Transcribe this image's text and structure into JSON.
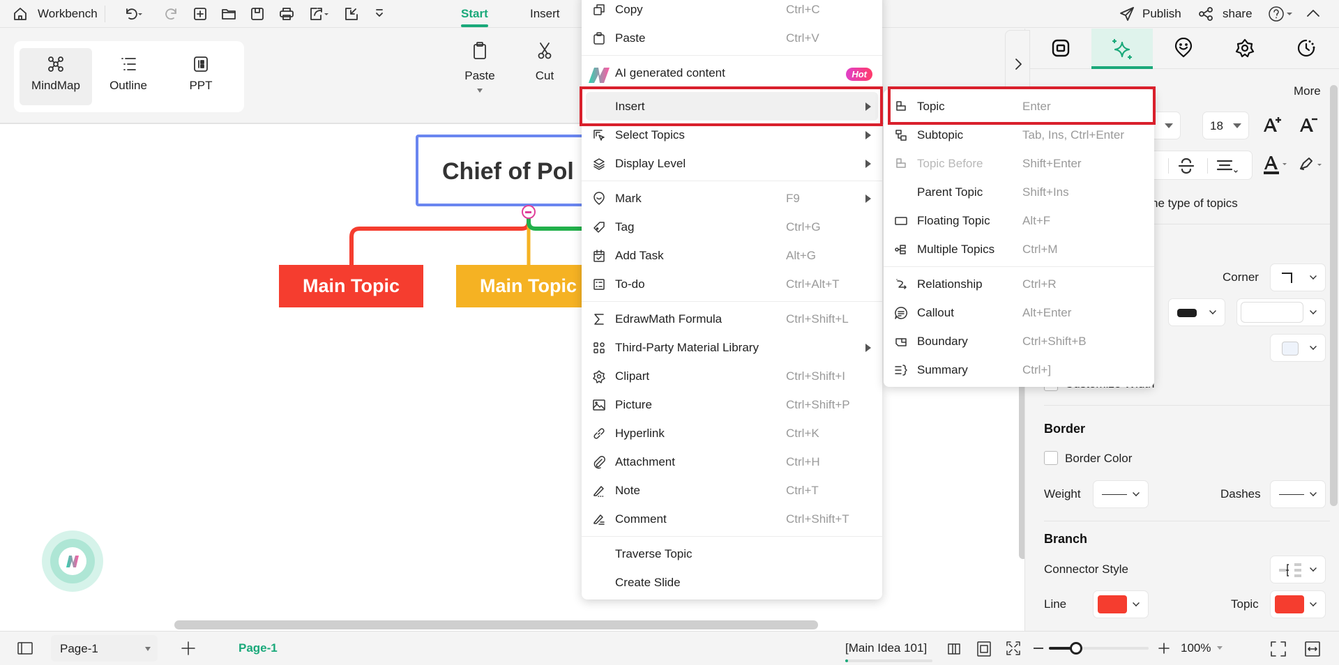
{
  "topbar": {
    "workbench_label": "Workbench",
    "tabs": [
      {
        "label": "Start",
        "active": true
      },
      {
        "label": "Insert",
        "active": false
      }
    ],
    "publish_label": "Publish",
    "share_label": "share"
  },
  "ribbon": {
    "views": [
      {
        "label": "MindMap",
        "selected": true
      },
      {
        "label": "Outline"
      },
      {
        "label": "PPT"
      }
    ],
    "paste_label": "Paste",
    "cut_label": "Cut"
  },
  "canvas": {
    "root_topic": "Chief of Pol",
    "main_topics": [
      {
        "label": "Main Topic",
        "color": "#f53d2f"
      },
      {
        "label": "Main Topic",
        "color": "#f5b223"
      }
    ],
    "branch_colors": {
      "red": "#f53d2f",
      "yellow": "#f5b223",
      "green": "#22b04b"
    },
    "root_border_color": "#6a86f0"
  },
  "context_menu": {
    "groups": [
      [
        {
          "label": "Copy",
          "shortcut": "Ctrl+C",
          "icon": "copy"
        },
        {
          "label": "Paste",
          "shortcut": "Ctrl+V",
          "icon": "paste"
        }
      ],
      [
        {
          "label": "AI generated content",
          "icon": "ai-logo",
          "badge": "Hot",
          "ai": true
        },
        {
          "label": "Insert",
          "submenu": true,
          "highlighted": true
        },
        {
          "label": "Select Topics",
          "icon": "select",
          "submenu": true
        },
        {
          "label": "Display Level",
          "icon": "layers",
          "submenu": true
        }
      ],
      [
        {
          "label": "Mark",
          "shortcut": "F9",
          "icon": "mark",
          "submenu": true
        },
        {
          "label": "Tag",
          "shortcut": "Ctrl+G",
          "icon": "tag"
        },
        {
          "label": "Add Task",
          "shortcut": "Alt+G",
          "icon": "task"
        },
        {
          "label": "To-do",
          "shortcut": "Ctrl+Alt+T",
          "icon": "todo"
        }
      ],
      [
        {
          "label": "EdrawMath Formula",
          "shortcut": "Ctrl+Shift+L",
          "icon": "sigma"
        },
        {
          "label": "Third-Party Material Library",
          "icon": "grid",
          "submenu": true
        },
        {
          "label": "Clipart",
          "shortcut": "Ctrl+Shift+I",
          "icon": "clipart"
        },
        {
          "label": "Picture",
          "shortcut": "Ctrl+Shift+P",
          "icon": "picture"
        },
        {
          "label": "Hyperlink",
          "shortcut": "Ctrl+K",
          "icon": "link"
        },
        {
          "label": "Attachment",
          "shortcut": "Ctrl+H",
          "icon": "clip"
        },
        {
          "label": "Note",
          "shortcut": "Ctrl+T",
          "icon": "note"
        },
        {
          "label": "Comment",
          "shortcut": "Ctrl+Shift+T",
          "icon": "comment"
        }
      ],
      [
        {
          "label": "Traverse Topic"
        },
        {
          "label": "Create Slide"
        }
      ]
    ]
  },
  "insert_submenu": {
    "groups": [
      [
        {
          "label": "Topic",
          "shortcut": "Enter",
          "icon": "topic"
        },
        {
          "label": "Subtopic",
          "shortcut": "Tab, Ins, Ctrl+Enter",
          "icon": "subtopic"
        },
        {
          "label": "Topic Before",
          "shortcut": "Shift+Enter",
          "icon": "topic",
          "disabled": true
        },
        {
          "label": "Parent Topic",
          "shortcut": "Shift+Ins"
        },
        {
          "label": "Floating Topic",
          "shortcut": "Alt+F",
          "icon": "floating"
        },
        {
          "label": "Multiple Topics",
          "shortcut": "Ctrl+M",
          "icon": "multiple"
        }
      ],
      [
        {
          "label": "Relationship",
          "shortcut": "Ctrl+R",
          "icon": "relationship"
        },
        {
          "label": "Callout",
          "shortcut": "Alt+Enter",
          "icon": "callout"
        },
        {
          "label": "Boundary",
          "shortcut": "Ctrl+Shift+B",
          "icon": "boundary"
        },
        {
          "label": "Summary",
          "shortcut": "Ctrl+]",
          "icon": "summary"
        }
      ]
    ]
  },
  "panel": {
    "more_label": "More",
    "font_size": "18",
    "hint_text": "ne type of topics",
    "corner_label": "Corner",
    "customize_width_label": "Customize Width",
    "border_heading": "Border",
    "border_color_label": "Border Color",
    "weight_label": "Weight",
    "dashes_label": "Dashes",
    "branch_heading": "Branch",
    "connector_style_label": "Connector Style",
    "line_label": "Line",
    "topic_label": "Topic",
    "text_color_swatch": "#1e1e1e",
    "fill_swatch": "#eef3fb",
    "line_color": "#f53d2f",
    "topic_color": "#f53d2f"
  },
  "bottombar": {
    "page_select": "Page-1",
    "page_tab": "Page-1",
    "status": "[Main Idea 101]",
    "zoom": "100%",
    "zoom_level_percent": 100
  }
}
